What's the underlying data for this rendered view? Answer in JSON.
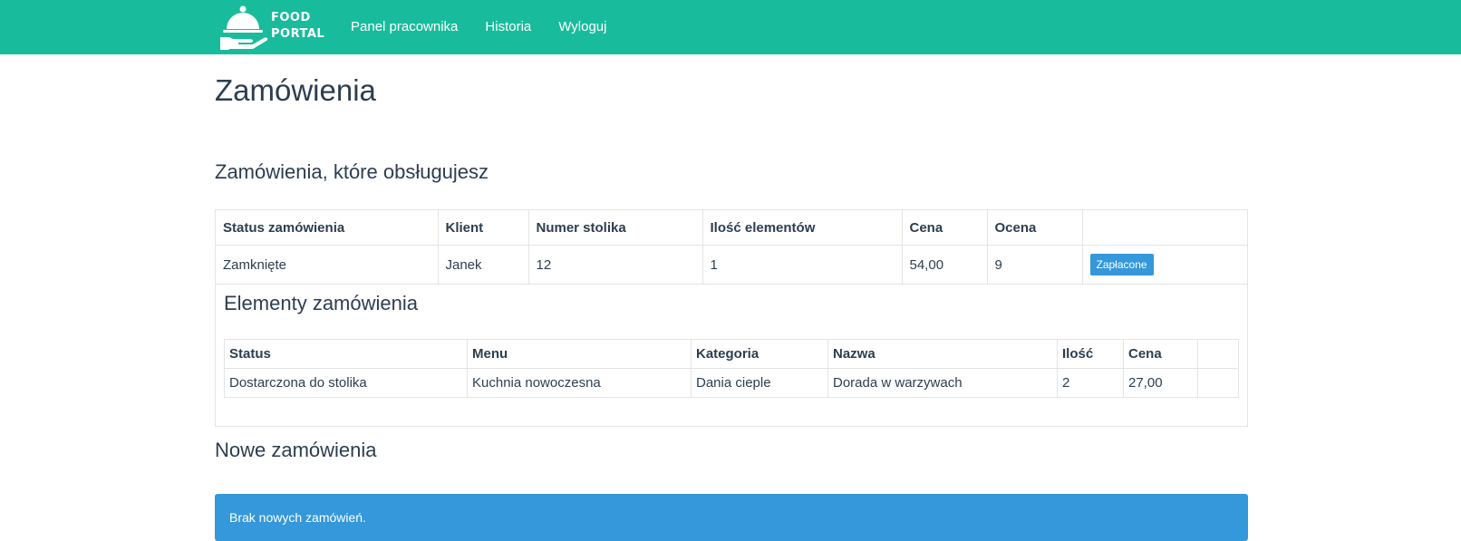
{
  "brand": {
    "line1": "FOOD",
    "line2": "PORTAL"
  },
  "nav": {
    "links": [
      "Panel pracownika",
      "Historia",
      "Wyloguj"
    ]
  },
  "page": {
    "title": "Zamówienia",
    "handled_title": "Zamówienia, które obsługujesz",
    "new_title": "Nowe zamówienia"
  },
  "orders": {
    "headers": [
      "Status zamówienia",
      "Klient",
      "Numer stolika",
      "Ilość elementów",
      "Cena",
      "Ocena",
      ""
    ],
    "row": {
      "status": "Zamknięte",
      "client": "Janek",
      "table": "12",
      "count": "1",
      "price": "54,00",
      "rating": "9",
      "button": "Zapłacone"
    }
  },
  "items": {
    "title": "Elementy zamówienia",
    "headers": [
      "Status",
      "Menu",
      "Kategoria",
      "Nazwa",
      "Ilość",
      "Cena",
      ""
    ],
    "row": {
      "status": "Dostarczona do stolika",
      "menu": "Kuchnia nowoczesna",
      "category": "Dania cieple",
      "name": "Dorada w warzywach",
      "qty": "2",
      "price": "27,00"
    }
  },
  "alert": {
    "text": "Brak nowych zamówień."
  },
  "colors": {
    "navbar": "#18bc9c",
    "primary": "#3498db",
    "text": "#2c3e50"
  }
}
